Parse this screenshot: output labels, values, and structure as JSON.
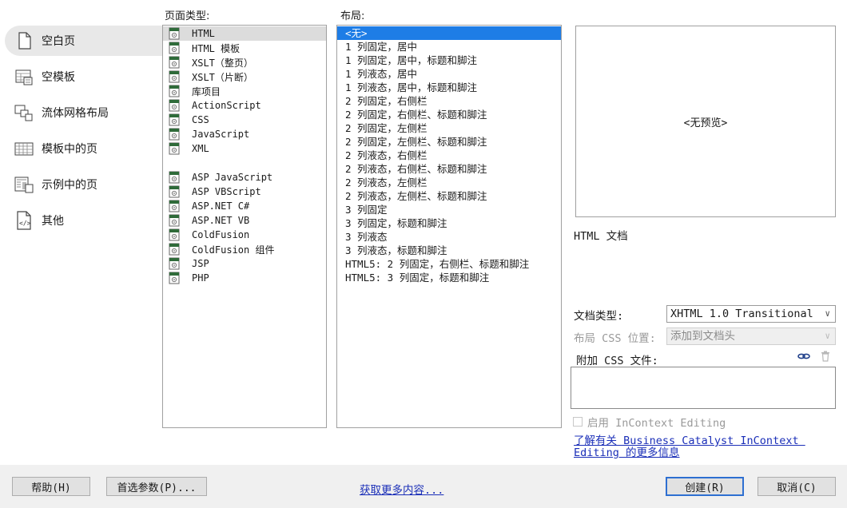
{
  "categories": [
    {
      "label": "空白页",
      "icon": "blank-page-icon",
      "selected": true
    },
    {
      "label": "空模板",
      "icon": "blank-template-icon",
      "selected": false
    },
    {
      "label": "流体网格布局",
      "icon": "fluid-grid-layout-icon",
      "selected": false
    },
    {
      "label": "模板中的页",
      "icon": "page-from-template-icon",
      "selected": false
    },
    {
      "label": "示例中的页",
      "icon": "page-from-sample-icon",
      "selected": false
    },
    {
      "label": "其他",
      "icon": "code-file-icon",
      "selected": false
    }
  ],
  "page_type": {
    "label": "页面类型:",
    "items": [
      "HTML",
      "HTML 模板",
      "XSLT（整页）",
      "XSLT（片断）",
      "库项目",
      "ActionScript",
      "CSS",
      "JavaScript",
      "XML",
      "",
      "ASP JavaScript",
      "ASP VBScript",
      "ASP.NET C#",
      "ASP.NET VB",
      "ColdFusion",
      "ColdFusion 组件",
      "JSP",
      "PHP"
    ],
    "selected_index": 0
  },
  "layout": {
    "label": "布局:",
    "items": [
      "<无>",
      "1 列固定，居中",
      "1 列固定，居中，标题和脚注",
      "1 列液态，居中",
      "1 列液态，居中，标题和脚注",
      "2 列固定，右侧栏",
      "2 列固定，右侧栏、标题和脚注",
      "2 列固定，左侧栏",
      "2 列固定，左侧栏、标题和脚注",
      "2 列液态，右侧栏",
      "2 列液态，右侧栏、标题和脚注",
      "2 列液态，左侧栏",
      "2 列液态，左侧栏、标题和脚注",
      "3 列固定",
      "3 列固定，标题和脚注",
      "3 列液态",
      "3 列液态，标题和脚注",
      "HTML5: 2 列固定，右侧栏、标题和脚注",
      "HTML5: 3 列固定，标题和脚注"
    ],
    "selected_index": 0
  },
  "preview": {
    "placeholder": "<无预览>",
    "description": "HTML 文档"
  },
  "options": {
    "doctype_label": "文档类型:",
    "doctype_value": "XHTML 1.0 Transitional",
    "css_position_label": "布局 CSS 位置:",
    "css_position_value": "添加到文档头",
    "attach_css_label": "附加 CSS 文件:",
    "attach_icon": "link-chain-icon",
    "delete_icon": "trash-icon",
    "incontext_label": "启用 InContext Editing",
    "incontext_checked": false,
    "learn_more_line1": "了解有关 Business Catalyst InContext ",
    "learn_more_line2": "Editing 的更多信息"
  },
  "footer": {
    "help": "帮助(H)",
    "preferences": "首选参数(P)...",
    "get_more": "获取更多内容...",
    "create": "创建(R)",
    "cancel": "取消(C)"
  },
  "colors": {
    "selection": "#1e7de6",
    "link": "#1b2fb8"
  }
}
